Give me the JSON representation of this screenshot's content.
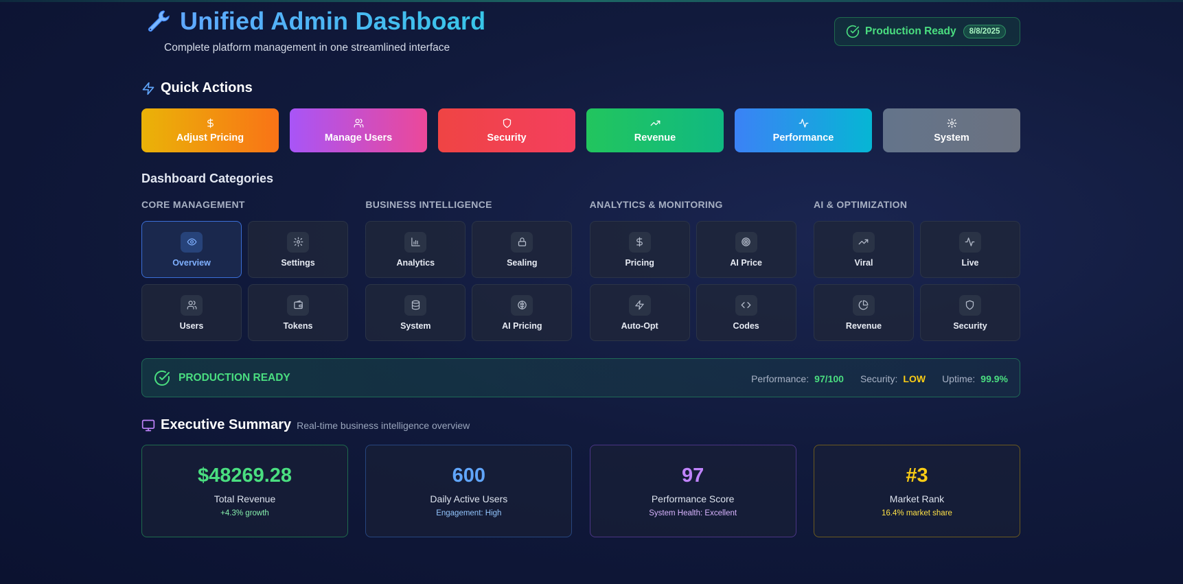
{
  "header": {
    "title": "Unified Admin Dashboard",
    "subtitle": "Complete platform management in one streamlined interface",
    "status_label": "Production Ready",
    "status_date": "8/8/2025"
  },
  "quick_actions": {
    "title": "Quick Actions",
    "items": [
      {
        "label": "Adjust Pricing",
        "icon": "dollar-icon",
        "colors": [
          "#eab308",
          "#f97316"
        ]
      },
      {
        "label": "Manage Users",
        "icon": "users-icon",
        "colors": [
          "#a855f7",
          "#ec4899"
        ]
      },
      {
        "label": "Security",
        "icon": "shield-icon",
        "colors": [
          "#ef4444",
          "#f43f5e"
        ]
      },
      {
        "label": "Revenue",
        "icon": "trending-up-icon",
        "colors": [
          "#22c55e",
          "#10b981"
        ]
      },
      {
        "label": "Performance",
        "icon": "activity-icon",
        "colors": [
          "#3b82f6",
          "#06b6d4"
        ]
      },
      {
        "label": "System",
        "icon": "gear-icon",
        "colors": [
          "#64748b",
          "#6b7280"
        ]
      }
    ]
  },
  "categories": {
    "title": "Dashboard Categories",
    "groups": [
      {
        "label": "CORE MANAGEMENT",
        "tiles": [
          {
            "label": "Overview",
            "icon": "eye-icon",
            "active": true
          },
          {
            "label": "Settings",
            "icon": "gear-icon"
          },
          {
            "label": "Users",
            "icon": "users-icon"
          },
          {
            "label": "Tokens",
            "icon": "wallet-icon"
          }
        ]
      },
      {
        "label": "BUSINESS INTELLIGENCE",
        "tiles": [
          {
            "label": "Analytics",
            "icon": "bar-chart-icon"
          },
          {
            "label": "Sealing",
            "icon": "lock-icon"
          },
          {
            "label": "System",
            "icon": "database-icon"
          },
          {
            "label": "AI Pricing",
            "icon": "brain-icon"
          }
        ]
      },
      {
        "label": "ANALYTICS & MONITORING",
        "tiles": [
          {
            "label": "Pricing",
            "icon": "dollar-icon"
          },
          {
            "label": "AI Price",
            "icon": "target-icon"
          },
          {
            "label": "Auto-Opt",
            "icon": "zap-icon"
          },
          {
            "label": "Codes",
            "icon": "code-icon"
          }
        ]
      },
      {
        "label": "AI & OPTIMIZATION",
        "tiles": [
          {
            "label": "Viral",
            "icon": "trending-up-icon"
          },
          {
            "label": "Live",
            "icon": "activity-icon"
          },
          {
            "label": "Revenue",
            "icon": "pie-chart-icon"
          },
          {
            "label": "Security",
            "icon": "shield-icon"
          }
        ]
      }
    ]
  },
  "production": {
    "label": "PRODUCTION READY",
    "performance_label": "Performance:",
    "performance_value": "97/100",
    "security_label": "Security:",
    "security_value": "LOW",
    "uptime_label": "Uptime:",
    "uptime_value": "99.9%"
  },
  "executive": {
    "title": "Executive Summary",
    "subtitle": "Real-time business intelligence overview",
    "cards": [
      {
        "value": "$48269.28",
        "label": "Total Revenue",
        "sub": "+4.3% growth",
        "color": "#4ade80",
        "sub_color": "#86efac",
        "border": "#1f6b4d"
      },
      {
        "value": "600",
        "label": "Daily Active Users",
        "sub": "Engagement: High",
        "color": "#60a5fa",
        "sub_color": "#93c5fd",
        "border": "#27467f"
      },
      {
        "value": "97",
        "label": "Performance Score",
        "sub": "System Health: Excellent",
        "color": "#c084fc",
        "sub_color": "#d8b4fe",
        "border": "#4b3585"
      },
      {
        "value": "#3",
        "label": "Market Rank",
        "sub": "16.4% market share",
        "color": "#facc15",
        "sub_color": "#fde047",
        "border": "#6b5a1f"
      }
    ]
  },
  "colors": {
    "green": "#4ade80",
    "yellow": "#facc15"
  }
}
